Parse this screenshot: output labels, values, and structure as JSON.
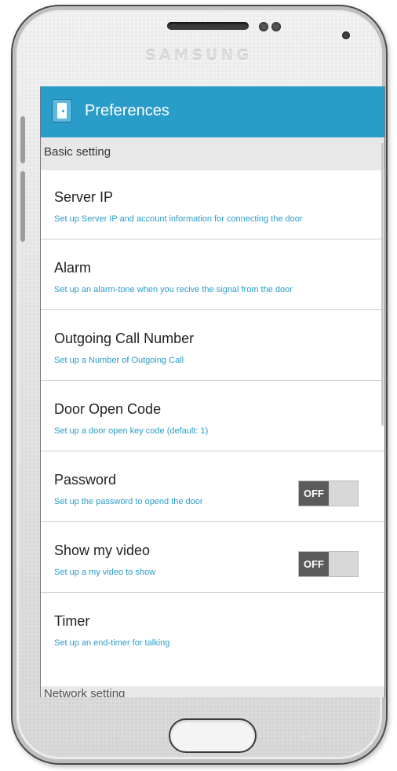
{
  "device": {
    "brand": "SAMSUNG",
    "home_button": "home",
    "back_key_icon": "back-arrow-icon",
    "menu_key_icon": "menu-icon"
  },
  "app_bar": {
    "icon": "door-icon",
    "title": "Preferences",
    "color": "#2a9cc9"
  },
  "sections": [
    {
      "header": "Basic setting",
      "items": [
        {
          "title": "Server IP",
          "subtitle": "Set up Server IP and account information for connecting the door"
        },
        {
          "title": "Alarm",
          "subtitle": "Set up an alarm-tone when you recive the signal from the door"
        },
        {
          "title": "Outgoing Call Number",
          "subtitle": "Set up a Number of Outgoing Call"
        },
        {
          "title": "Door Open Code",
          "subtitle": "Set up a door open key code (default: 1)"
        },
        {
          "title": "Password",
          "subtitle": "Set up the password to opend the door",
          "toggle": "OFF"
        },
        {
          "title": "Show my video",
          "subtitle": "Set up a my video to show",
          "toggle": "OFF"
        },
        {
          "title": "Timer",
          "subtitle": "Set up an end-timer for talking"
        }
      ]
    },
    {
      "header": "Network setting"
    }
  ]
}
